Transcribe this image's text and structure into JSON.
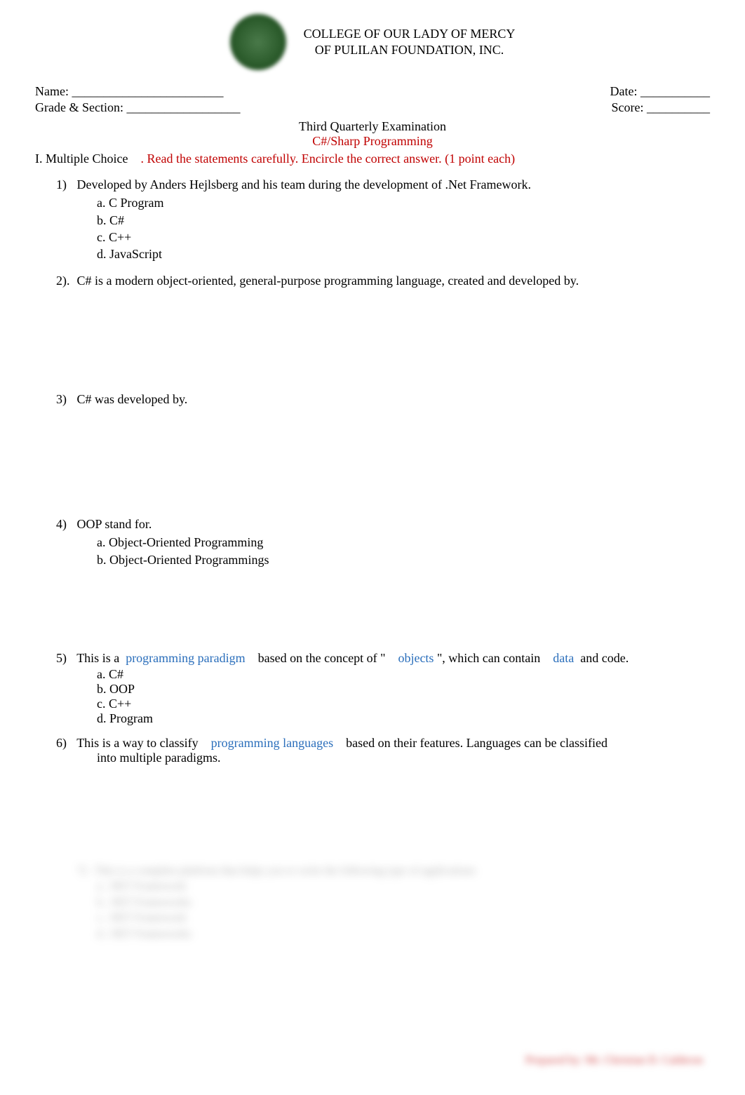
{
  "college": {
    "line1": "COLLEGE OF OUR LADY OF MERCY",
    "line2": "OF PULILAN FOUNDATION, INC."
  },
  "fields": {
    "name_label": "Name: ________________________",
    "date_label": "Date: ___________",
    "grade_label": "Grade & Section: __________________",
    "score_label": "Score: __________"
  },
  "exam": {
    "title": "Third Quarterly Examination",
    "subject": "C#/Sharp Programming"
  },
  "section1": {
    "label": "I. Multiple Choice",
    "instruction": ". Read the statements carefully. Encircle the correct answer. (1 point each)"
  },
  "q1": {
    "num": "1)",
    "text": "Developed by Anders Hejlsberg and his team during the development of .Net Framework.",
    "a": "a. C Program",
    "b": "b. C#",
    "c": "c. C++",
    "d": "d. JavaScript"
  },
  "q2": {
    "num": "2).",
    "text": "C# is a modern object-oriented, general-purpose programming language, created and developed by."
  },
  "q3": {
    "num": "3)",
    "text": "C# was developed by."
  },
  "q4": {
    "num": "4)",
    "text": "OOP stand for.",
    "a": "a.  Object-Oriented Programming",
    "b": "b.  Object-Oriented Programmings"
  },
  "q5": {
    "num": "5)",
    "pre": "This is a",
    "link1": "programming paradigm",
    "mid1": "based on the concept of \"",
    "link2": "objects",
    "mid2": "\", which can contain",
    "link3": "data",
    "post": "and code.",
    "a": "a.  C#",
    "b": "b.  OOP",
    "c": "c.  C++",
    "d": "d. Program"
  },
  "q6": {
    "num": "6)",
    "pre": "This is a way to classify",
    "link1": "programming languages",
    "post": "based on their features. Languages can be classified",
    "cont": "into multiple paradigms."
  },
  "blur": {
    "q7num": "7)",
    "q7text": "This is a complete platform that helps you to write the following type of applications",
    "a": "a.  .NET Framework",
    "b": "b.  .NET Frameworks",
    "c": "c.  .NET Framework",
    "d": "d.  .NET Frameworks"
  },
  "footer": "Prepared by: Mr. Christian D. Calderon"
}
